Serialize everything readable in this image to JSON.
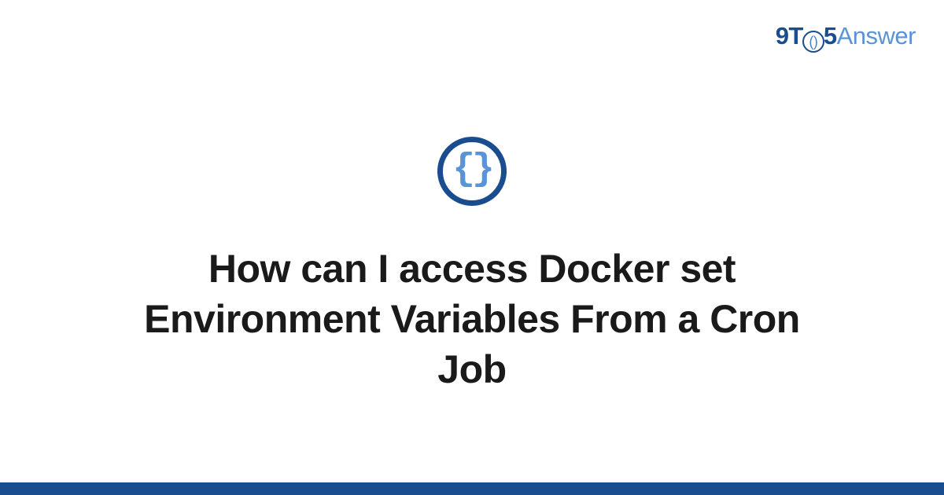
{
  "brand": {
    "prefix": "9T",
    "circle_content": "()",
    "middle": "5",
    "suffix": "Answer"
  },
  "icon": {
    "braces": "{}"
  },
  "title": "How can I access Docker set Environment Variables From a Cron Job",
  "colors": {
    "primary": "#1a4d8f",
    "secondary": "#5a94d6"
  }
}
